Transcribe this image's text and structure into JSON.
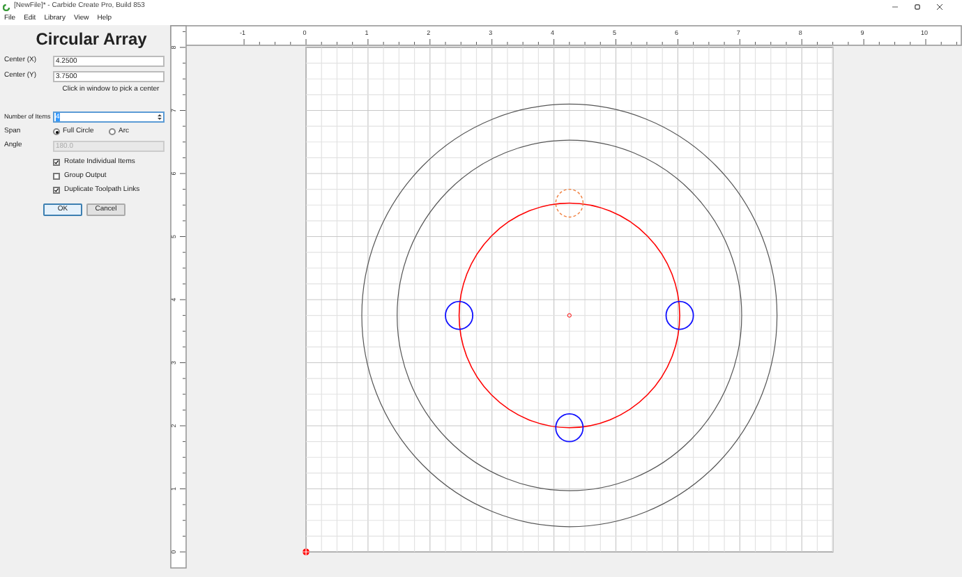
{
  "window": {
    "title": "[NewFile]* - Carbide Create Pro, Build 853"
  },
  "menu": [
    "File",
    "Edit",
    "Library",
    "View",
    "Help"
  ],
  "dialog": {
    "title": "Circular Array",
    "fields": [
      {
        "label": "Center (X)",
        "value": "4.2500"
      },
      {
        "label": "Center (Y)",
        "value": "3.7500"
      }
    ],
    "hint": "Click in window to pick a center",
    "number_of_items": {
      "label": "Number of Items",
      "value": "4"
    },
    "span": {
      "label": "Span",
      "options": [
        {
          "label": "Full Circle",
          "selected": true
        },
        {
          "label": "Arc",
          "selected": false
        }
      ]
    },
    "angle": {
      "label": "Angle",
      "value": "180.0",
      "disabled": true
    },
    "checkboxes": [
      {
        "label": "Rotate Individual Items",
        "checked": true
      },
      {
        "label": "Group Output",
        "checked": false
      },
      {
        "label": "Duplicate Toolpath Links",
        "checked": true
      }
    ],
    "buttons": [
      {
        "label": "OK",
        "default": true
      },
      {
        "label": "Cancel",
        "default": false
      }
    ]
  },
  "ruler": {
    "horizontal": [
      "-1",
      "0",
      "1",
      "2",
      "3",
      "4",
      "5",
      "6",
      "7",
      "8",
      "9",
      "10"
    ],
    "vertical": [
      "8",
      "7",
      "6",
      "5",
      "4",
      "3",
      "2",
      "1",
      "0"
    ]
  }
}
